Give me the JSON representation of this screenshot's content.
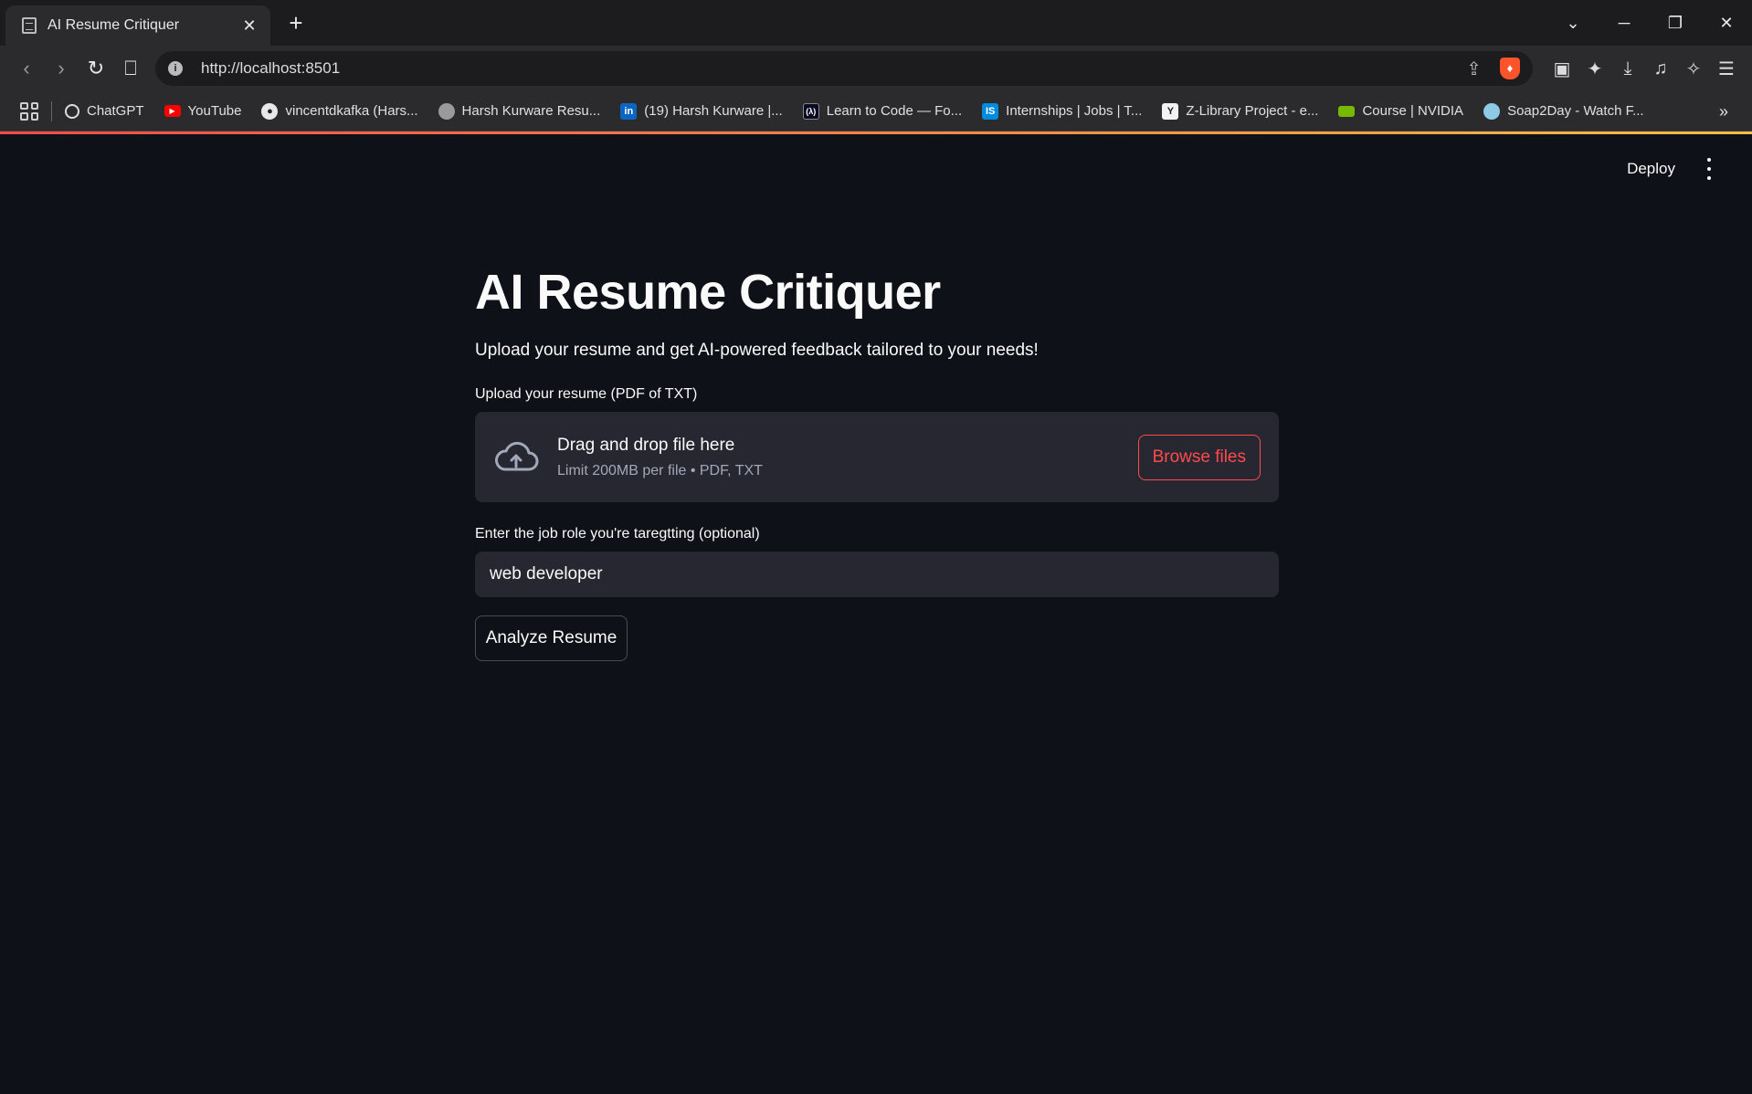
{
  "browser": {
    "tab_title": "AI Resume Critiquer",
    "tab_close": "✕",
    "new_tab": "+",
    "url": "http://localhost:8501",
    "window_controls": [
      "⌄",
      "─",
      "❐",
      "✕"
    ],
    "bookmarks": [
      {
        "label": "ChatGPT",
        "icon": "chatgpt-icon",
        "color": "#ffffff"
      },
      {
        "label": "YouTube",
        "icon": "youtube-icon",
        "color": "#ff0000"
      },
      {
        "label": "vincentdkafka (Hars...",
        "icon": "github-icon",
        "color": "#ffffff"
      },
      {
        "label": "Harsh Kurware Resu...",
        "icon": "globe-icon",
        "color": "#cccccc"
      },
      {
        "label": "(19) Harsh Kurware |...",
        "icon": "linkedin-icon",
        "color": "#0a66c2"
      },
      {
        "label": "Learn to Code — Fo...",
        "icon": "freecodecamp-icon",
        "color": "#0a0a23"
      },
      {
        "label": "Internships | Jobs | T...",
        "icon": "internshala-icon",
        "color": "#008bdc"
      },
      {
        "label": "Z-Library Project - e...",
        "icon": "zlibrary-icon",
        "color": "#ffffff"
      },
      {
        "label": "Course | NVIDIA",
        "icon": "nvidia-icon",
        "color": "#76b900"
      },
      {
        "label": "Soap2Day - Watch F...",
        "icon": "soap2day-icon",
        "color": "#8ecae6"
      }
    ],
    "bookmarks_more": "»"
  },
  "header": {
    "deploy_label": "Deploy"
  },
  "main": {
    "title": "AI Resume Critiquer",
    "subtitle": "Upload your resume and get AI-powered feedback tailored to your needs!",
    "upload_label": "Upload your resume (PDF of TXT)",
    "dropzone_title": "Drag and drop file here",
    "dropzone_limits": "Limit 200MB per file • PDF, TXT",
    "browse_label": "Browse files",
    "job_role_label": "Enter the job role you're taregtting (optional)",
    "job_role_value": "web developer",
    "analyze_label": "Analyze Resume"
  },
  "colors": {
    "background": "#0e1117",
    "widget": "#262730",
    "accent": "#ff4b4b"
  }
}
